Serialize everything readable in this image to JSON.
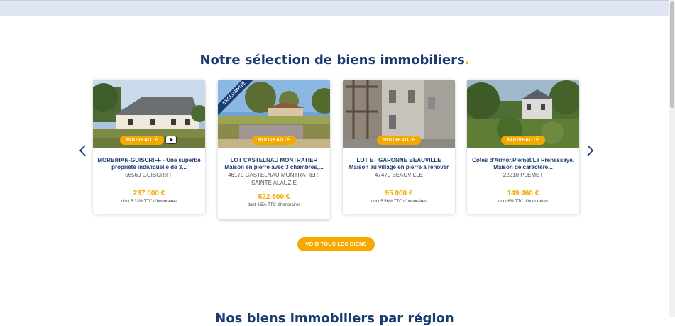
{
  "section": {
    "title": "Notre sélection de biens immobiliers",
    "title_dot": ".",
    "cta_label": "VOIR TOUS LES BIENS",
    "next_title": "Nos biens immobiliers par région"
  },
  "colors": {
    "brand_blue": "#1b3c72",
    "accent_orange": "#f5a800"
  },
  "listings": [
    {
      "badge": "NOUVEAUTÉ",
      "has_video": true,
      "title": "MORBIHAN-GUISCRIFF - Une superbe propriété individuelle de 3...",
      "city": "56560 GUISCRIFF",
      "price": "237 000 €",
      "fee": "dont 5.33% TTC d'honoraires"
    },
    {
      "badge": "NOUVEAUTÉ",
      "ribbon": "EXCLUSIVITÉ",
      "title": "LOT CASTELNAU MONTRATIER Maison en pierre avec 3 chambres,...",
      "city": "46170 CASTELNAU MONTRATIER-SAINTE ALAUZIE",
      "price": "522 500 €",
      "fee": "dont 4.5% TTC d'honoraires"
    },
    {
      "badge": "NOUVEAUTÉ",
      "title": "LOT ET GARONNE BEAUVILLE Maison au village en pierre à renover",
      "city": "47470 BEAUVILLE",
      "price": "95 000 €",
      "fee": "dont 5.56% TTC d'honoraires"
    },
    {
      "badge": "NOUVEAUTÉ",
      "title": "Cotes d'Armor.Plemet/La Prenessaye. Maison de caractère...",
      "city": "22210 PLÉMET",
      "price": "149 460 €",
      "fee": "dont 6% TTC d'honoraires"
    }
  ]
}
